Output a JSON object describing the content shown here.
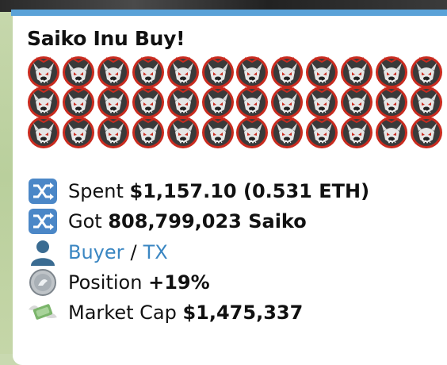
{
  "message": {
    "title": "Saiko Inu Buy!",
    "emoji_icon": "saiko-wolf-emoji",
    "emoji_rows": 3,
    "emoji_cols": 12,
    "spent": {
      "label": "Spent",
      "value": "$1,157.10 (0.531 ETH)",
      "icon": "shuffle-icon"
    },
    "got": {
      "label": "Got",
      "value": "808,799,023 Saiko",
      "icon": "shuffle-icon"
    },
    "links": {
      "buyer": "Buyer",
      "separator": "/",
      "tx": "TX",
      "icon": "person-silhouette-icon"
    },
    "position": {
      "label": "Position",
      "value": "+19%",
      "icon": "coin-icon"
    },
    "market_cap": {
      "label": "Market Cap",
      "value": "$1,475,337",
      "icon": "money-wings-icon"
    }
  },
  "colors": {
    "link": "#3a86c2",
    "accent_bar": "#5aa2d8",
    "shuffle_bg": "#4b87c7"
  }
}
